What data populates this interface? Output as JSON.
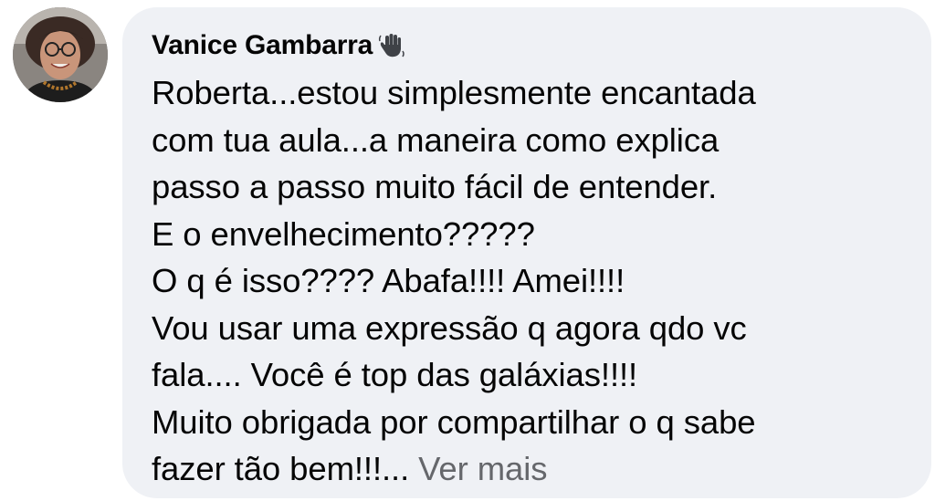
{
  "comment": {
    "author": "Vanice Gambarra",
    "badge_icon": "waving-hand-icon",
    "lines": [
      "Roberta...estou simplesmente encantada",
      "com tua aula...a maneira como explica",
      "passo a passo muito fácil de entender.",
      "E o envelhecimento?????",
      "O q é isso???? Abafa!!!! Amei!!!!",
      "Vou usar uma expressão q agora qdo vc",
      "fala.... Você é top das galáxias!!!!",
      "Muito obrigada por compartilhar o q sabe"
    ],
    "last_line": "fazer tão bem!!!",
    "ellipsis": "...",
    "see_more": "Ver mais"
  },
  "colors": {
    "bubble_bg": "#eff1f5",
    "text": "#050505",
    "secondary_text": "#65676b"
  }
}
